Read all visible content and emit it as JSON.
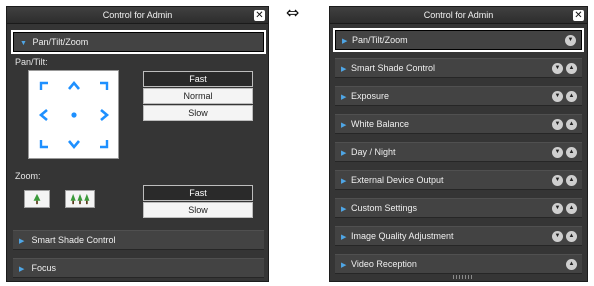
{
  "swap_symbol": "⇔",
  "left_panel": {
    "title": "Control for Admin",
    "close": "✕",
    "pan_tilt_zoom": "Pan/Tilt/Zoom",
    "pan_tilt_label": "Pan/Tilt:",
    "pan_speed": [
      "Fast",
      "Normal",
      "Slow"
    ],
    "pan_speed_selected": "Fast",
    "zoom_label": "Zoom:",
    "zoom_speed": [
      "Fast",
      "Slow"
    ],
    "zoom_speed_selected": "Fast",
    "sections": [
      "Smart Shade Control",
      "Focus"
    ]
  },
  "right_panel": {
    "title": "Control for Admin",
    "close": "✕",
    "sections": [
      {
        "label": "Pan/Tilt/Zoom",
        "buttons": [
          "down"
        ],
        "selected": true
      },
      {
        "label": "Smart Shade Control",
        "buttons": [
          "down",
          "up"
        ]
      },
      {
        "label": "Exposure",
        "buttons": [
          "down",
          "up"
        ]
      },
      {
        "label": "White Balance",
        "buttons": [
          "down",
          "up"
        ]
      },
      {
        "label": "Day / Night",
        "buttons": [
          "down",
          "up"
        ]
      },
      {
        "label": "External Device Output",
        "buttons": [
          "down",
          "up"
        ]
      },
      {
        "label": "Custom Settings",
        "buttons": [
          "down",
          "up"
        ]
      },
      {
        "label": "Image Quality Adjustment",
        "buttons": [
          "down",
          "up"
        ]
      },
      {
        "label": "Video Reception",
        "buttons": [
          "up"
        ]
      }
    ]
  },
  "colors": {
    "accent": "#1e90ff",
    "panel": "#353535",
    "header": "#434343"
  }
}
